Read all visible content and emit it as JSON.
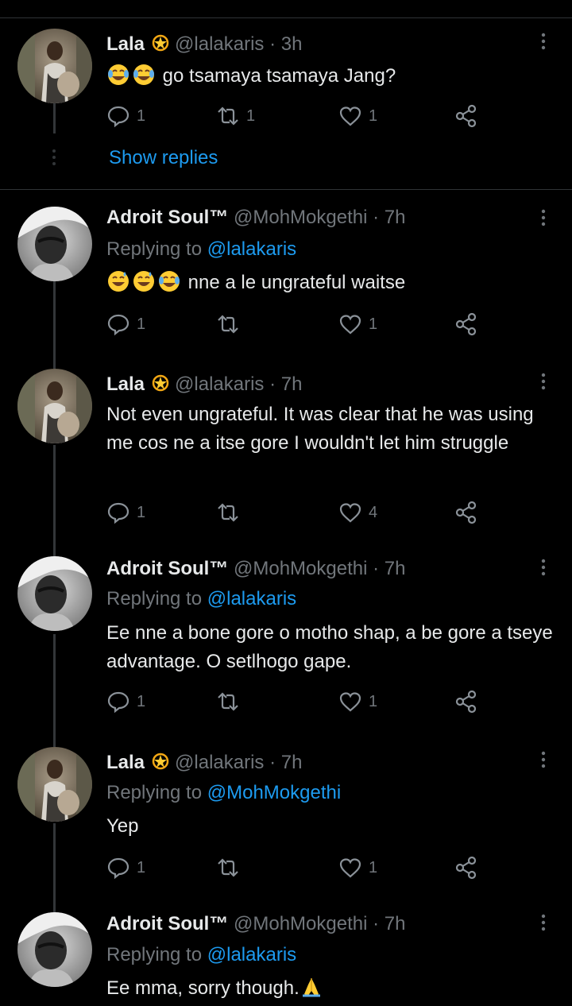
{
  "thread_actions": {
    "show_replies_label": "Show replies"
  },
  "tweets": [
    {
      "name": "Lala",
      "handle": "@lalakaris",
      "time": "3h",
      "reply_prefix": "",
      "reply_to": "",
      "text": "go tsamaya tsamaya Jang?",
      "emojis": [
        "face-with-tears-of-joy",
        "face-with-tears-of-joy"
      ],
      "replies": "1",
      "retweets": "1",
      "likes": "1"
    },
    {
      "name": "Adroit Soul™",
      "handle": "@MohMokgethi",
      "time": "7h",
      "reply_prefix": "Replying to",
      "reply_to": "@lalakaris",
      "text": "nne a le ungrateful waitse",
      "emojis": [
        "grinning-sweat-face",
        "grinning-sweat-face",
        "face-with-tears-of-joy"
      ],
      "replies": "1",
      "retweets": "",
      "likes": "1"
    },
    {
      "name": "Lala",
      "handle": "@lalakaris",
      "time": "7h",
      "reply_prefix": "",
      "reply_to": "",
      "text": "Not even ungrateful. It was clear that he was using me cos ne a itse gore I wouldn't let him struggle",
      "emojis": [],
      "replies": "1",
      "retweets": "",
      "likes": "4"
    },
    {
      "name": "Adroit Soul™",
      "handle": "@MohMokgethi",
      "time": "7h",
      "reply_prefix": "Replying to",
      "reply_to": "@lalakaris",
      "text": "Ee nne a bone gore o motho shap, a be gore a tseye advantage. O setlhogo gape.",
      "emojis": [],
      "replies": "1",
      "retweets": "",
      "likes": "1"
    },
    {
      "name": "Lala",
      "handle": "@lalakaris",
      "time": "7h",
      "reply_prefix": "Replying to",
      "reply_to": "@MohMokgethi",
      "text": "Yep",
      "emojis": [],
      "replies": "1",
      "retweets": "",
      "likes": "1"
    },
    {
      "name": "Adroit Soul™",
      "handle": "@MohMokgethi",
      "time": "7h",
      "reply_prefix": "Replying to",
      "reply_to": "@lalakaris",
      "text": "Ee mma, sorry though.",
      "emojis": [
        "folded-hands"
      ],
      "replies": "",
      "retweets": "",
      "likes": ""
    }
  ],
  "colors": {
    "background": "#000000",
    "text": "#e7e9ea",
    "muted": "#71767b",
    "accent": "#1d9bf0",
    "divider": "#2f3336"
  }
}
